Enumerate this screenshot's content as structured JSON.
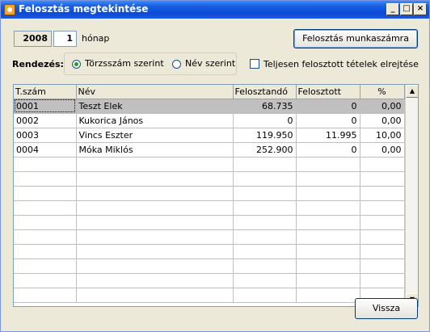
{
  "window": {
    "title": "Felosztás megtekintése",
    "controls": {
      "minimize": "_",
      "maximize": "□",
      "close": "×"
    }
  },
  "period": {
    "year": "2008",
    "month": "1",
    "month_label": "hónap"
  },
  "allocation_sheet_button": "Felosztás munkaszámra",
  "sort": {
    "label": "Rendezés:",
    "options": [
      {
        "label": "Törzsszám szerint",
        "checked": true
      },
      {
        "label": "Név szerint",
        "checked": false
      }
    ]
  },
  "hide_fully_allocated": {
    "label": "Teljesen felosztott tételek elrejtése",
    "checked": false
  },
  "table": {
    "columns": [
      "T.szám",
      "Név",
      "Felosztandó",
      "Felosztott",
      "%"
    ],
    "rows": [
      [
        "0001",
        "Teszt Elek",
        "68.735",
        "0",
        "0,00"
      ],
      [
        "0002",
        "Kukorica János",
        "0",
        "0",
        "0,00"
      ],
      [
        "0003",
        "Vincs Eszter",
        "119.950",
        "11.995",
        "10,00"
      ],
      [
        "0004",
        "Móka Miklós",
        "252.900",
        "0",
        "0,00"
      ]
    ],
    "selected_row": 0
  },
  "back_button": "Vissza"
}
